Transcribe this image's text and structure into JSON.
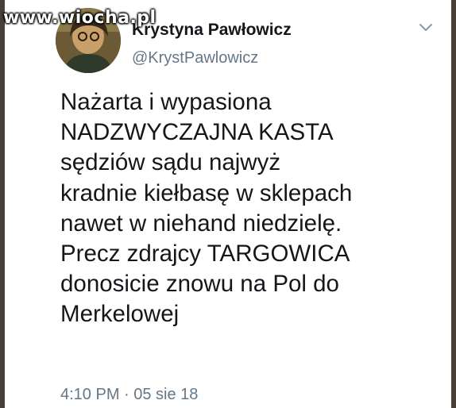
{
  "watermark": "www.wiocha.pl",
  "author": {
    "name": "Krystyna Pawłowicz",
    "handle": "@KrystPawlowicz"
  },
  "tweet": {
    "lines": [
      "Nażarta i wypasiona",
      "NADZWYCZAJNA KASTA",
      "sędziów sądu najwyż",
      "kradnie kiełbasę w sklepach",
      "nawet w niehand niedzielę.",
      "Precz zdrajcy TARGOWICA",
      "donosicie znowu na Pol do",
      "Merkelowej"
    ],
    "timestamp": "4:10 PM · 05 sie 18"
  },
  "icons": {
    "menu": "chevron-down-icon",
    "avatar": "profile-photo"
  },
  "colors": {
    "text": "#14171a",
    "secondary": "#657786",
    "background": "#ffffff",
    "frame": "#4a3f37"
  }
}
